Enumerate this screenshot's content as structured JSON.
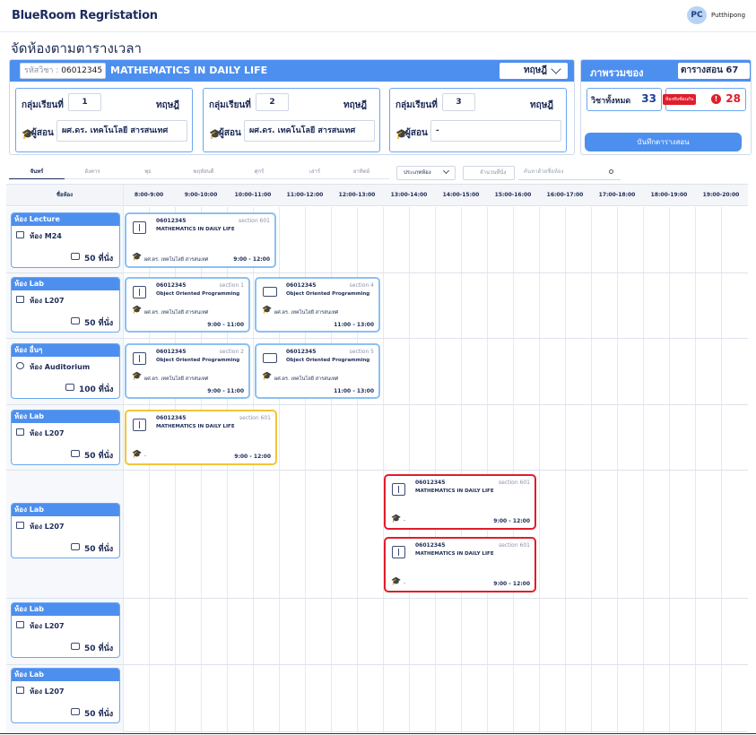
{
  "app": {
    "title": "BlueRoom Regristation",
    "user_initials": "PC",
    "user_name": "Putthipong"
  },
  "page_title": "จัดห้องตามตารางเวลา",
  "course": {
    "code_label": "รหัสวิชา :",
    "code": "06012345",
    "name": "MATHEMATICS IN DAILY LIFE",
    "type": "ทฤษฎี",
    "sections": [
      {
        "label": "กลุ่มเรียนที่",
        "number": "1",
        "type": "ทฤษฎี",
        "teacher_label": "ผู้สอน",
        "teacher": "ผศ.ดร. เทคโนโลยี สารสนเทศ"
      },
      {
        "label": "กลุ่มเรียนที่",
        "number": "2",
        "type": "ทฤษฎี",
        "teacher_label": "ผู้สอน",
        "teacher": "ผศ.ดร. เทคโนโลยี สารสนเทศ"
      },
      {
        "label": "กลุ่มเรียนที่",
        "number": "3",
        "type": "ทฤษฎี",
        "teacher_label": "ผู้สอน",
        "teacher": "-"
      }
    ]
  },
  "summary": {
    "title": "ภาพรวมของ",
    "select": "ตารางสอน 67",
    "total_label": "วิชาทั้งหมด",
    "total": "33",
    "conflict_label": "ห้องทับซ้อนกัน",
    "conflict": "28",
    "save_label": "บันทึกตารางสอน"
  },
  "days": [
    "จันทร์",
    "อังคาร",
    "พุธ",
    "พฤหัสบดี",
    "ศุกร์",
    "เสาร์",
    "อาทิตย์"
  ],
  "filters": {
    "room_type": "ประเภทห้อง",
    "seats": "จำนวนที่นั่ง",
    "search_placeholder": "ค้นหาด้วยชื่อห้อง"
  },
  "grid": {
    "room_header": "ชื่อห้อง",
    "times": [
      "8:00-9:00",
      "9:00-10:00",
      "10:00-11:00",
      "11:00-12:00",
      "12:00-13:00",
      "13:00-14:00",
      "14:00-15:00",
      "15:00-16:00",
      "16:00-17:00",
      "17:00-18:00",
      "18:00-19:00",
      "19:00-20:00"
    ]
  },
  "rooms": [
    {
      "type": "ห้อง Lecture",
      "name": "ห้อง M24",
      "seats": "50 ที่นั่ง"
    },
    {
      "type": "ห้อง Lab",
      "name": "ห้อง L207",
      "seats": "50 ที่นั่ง"
    },
    {
      "type": "ห้อง อื่นๆ",
      "name": "ห้อง Auditorium",
      "seats": "100 ที่นั่ง"
    },
    {
      "type": "ห้อง Lab",
      "name": "ห้อง L207",
      "seats": "50 ที่นั่ง"
    },
    {
      "type": "ห้อง Lab",
      "name": "ห้อง L207",
      "seats": "50 ที่นั่ง"
    },
    {
      "type": "ห้อง Lab",
      "name": "ห้อง L207",
      "seats": "50 ที่นั่ง"
    },
    {
      "type": "ห้อง Lab",
      "name": "ห้อง L207",
      "seats": "50 ที่นั่ง"
    }
  ],
  "classes": [
    {
      "code": "06012345",
      "section": "section 601",
      "name": "MATHEMATICS IN DAILY LIFE",
      "teacher": "ผศ.ดร. เทคโนโลยี สารสนเทศ",
      "time": "9:00 - 12:00"
    },
    {
      "code": "06012345",
      "section": "section 1",
      "name": "Object Oriented Programming",
      "teacher": "ผศ.ดร. เทคโนโลยี สารสนเทศ",
      "time": "9:00 - 11:00"
    },
    {
      "code": "06012345",
      "section": "section 4",
      "name": "Object Oriented Programming",
      "teacher": "ผศ.ดร. เทคโนโลยี สารสนเทศ",
      "time": "11:00 - 13:00"
    },
    {
      "code": "06012345",
      "section": "section 2",
      "name": "Object Oriented Programming",
      "teacher": "ผศ.ดร. เทคโนโลยี สารสนเทศ",
      "time": "9:00 - 11:00"
    },
    {
      "code": "06012345",
      "section": "section 5",
      "name": "Object Oriented Programming",
      "teacher": "ผศ.ดร. เทคโนโลยี สารสนเทศ",
      "time": "11:00 - 13:00"
    },
    {
      "code": "06012345",
      "section": "section 601",
      "name": "MATHEMATICS IN DAILY LIFE",
      "teacher": "-",
      "time": "9:00 - 12:00"
    },
    {
      "code": "06012345",
      "section": "section 601",
      "name": "MATHEMATICS IN DAILY LIFE",
      "teacher": "-",
      "time": "9:00 - 12:00"
    },
    {
      "code": "06012345",
      "section": "section 601",
      "name": "MATHEMATICS IN DAILY LIFE",
      "teacher": "-",
      "time": "9:00 - 12:00"
    }
  ]
}
